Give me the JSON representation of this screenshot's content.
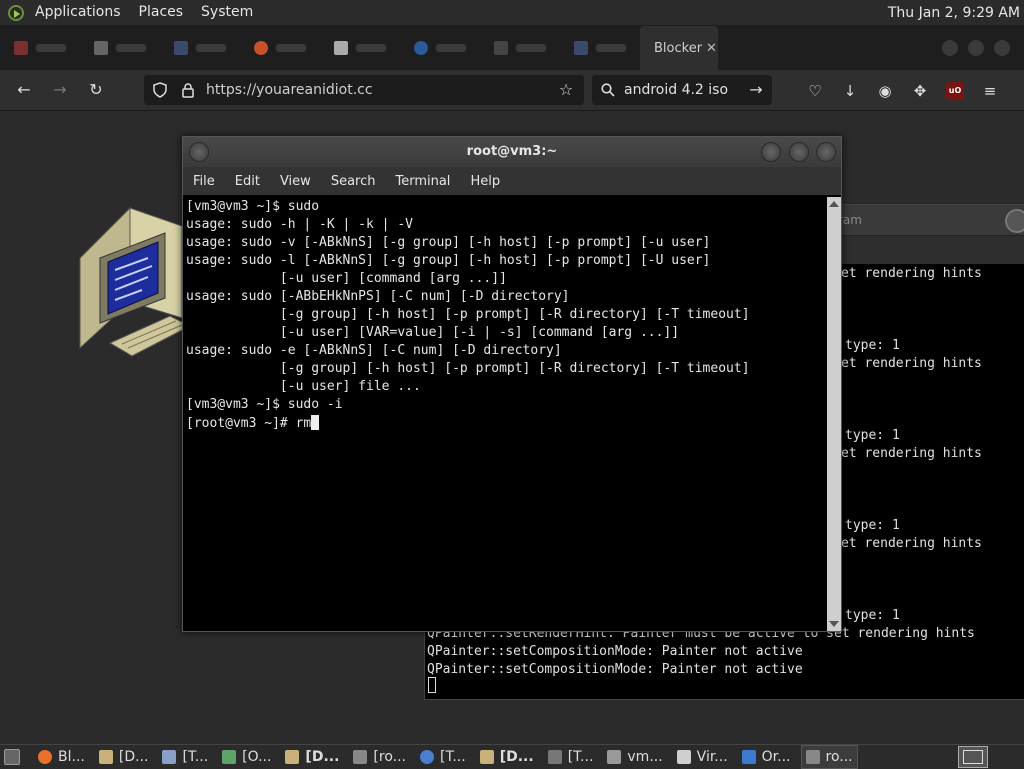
{
  "top_panel": {
    "menus": [
      "Applications",
      "Places",
      "System"
    ],
    "clock": "Thu Jan  2,  9:29 AM"
  },
  "browser": {
    "active_tab": {
      "title": "Blocker",
      "close": "✕"
    },
    "url": "https://youareanidiot.cc",
    "search": "android 4.2 iso",
    "colors": {
      "background": "#2b2b2b",
      "toolbar": "#2f2f2f",
      "field": "#1c1c1c"
    }
  },
  "terminal": {
    "title": "root@vm3:~",
    "menu": [
      "File",
      "Edit",
      "View",
      "Search",
      "Terminal",
      "Help"
    ],
    "lines": [
      "[vm3@vm3 ~]$ sudo",
      "usage: sudo -h | -K | -k | -V",
      "usage: sudo -v [-ABkNnS] [-g group] [-h host] [-p prompt] [-u user]",
      "usage: sudo -l [-ABkNnS] [-g group] [-h host] [-p prompt] [-U user]",
      "            [-u user] [command [arg ...]]",
      "usage: sudo [-ABbEHkNnPS] [-C num] [-D directory]",
      "            [-g group] [-h host] [-p prompt] [-R directory] [-T timeout]",
      "            [-u user] [VAR=value] [-i | -s] [command [arg ...]]",
      "usage: sudo -e [-ABkNnS] [-C num] [-D directory]",
      "            [-g group] [-h host] [-p prompt] [-R directory] [-T timeout]",
      "            [-u user] file ...",
      "[vm3@vm3 ~]$ sudo -i"
    ],
    "prompt": "[root@vm3 ~]# rm"
  },
  "bg_terminal": {
    "title_fragment": "ram",
    "lines": [
      "et rendering hints",
      "type: 1",
      "et rendering hints",
      "type: 1",
      "et rendering hints",
      "type: 1",
      "et rendering hints",
      "type: 1",
      "QPainter::setRenderHint: Painter must be active to set rendering hints",
      "QPainter::setCompositionMode: Painter not active",
      "QPainter::setCompositionMode: Painter not active"
    ]
  },
  "taskbar": {
    "tasks": [
      {
        "label": "Bl...",
        "icon": "firefox-icon",
        "color": "#e8702a"
      },
      {
        "label": "[D...",
        "icon": "folder-icon",
        "color": "#c9b27a"
      },
      {
        "label": "[T...",
        "icon": "printer-icon",
        "color": "#8aa0c8"
      },
      {
        "label": "[O...",
        "icon": "app-icon",
        "color": "#5fa36b"
      },
      {
        "label": "[D...",
        "icon": "folder-icon",
        "color": "#c9b27a"
      },
      {
        "label": "[ro...",
        "icon": "terminal-icon",
        "color": "#888888"
      },
      {
        "label": "[T...",
        "icon": "chromium-icon",
        "color": "#4a7fd0"
      },
      {
        "label": "[D...",
        "icon": "folder-icon",
        "color": "#c9b27a"
      },
      {
        "label": "[T...",
        "icon": "document-icon",
        "color": "#777777"
      },
      {
        "label": "vm...",
        "icon": "image-icon",
        "color": "#9a9a9a"
      },
      {
        "label": "Vir...",
        "icon": "window-icon",
        "color": "#cfcfcf"
      },
      {
        "label": "Or...",
        "icon": "virtualbox-icon",
        "color": "#3c7bd1"
      },
      {
        "label": "ro...",
        "icon": "terminal-icon",
        "color": "#888888"
      }
    ]
  }
}
